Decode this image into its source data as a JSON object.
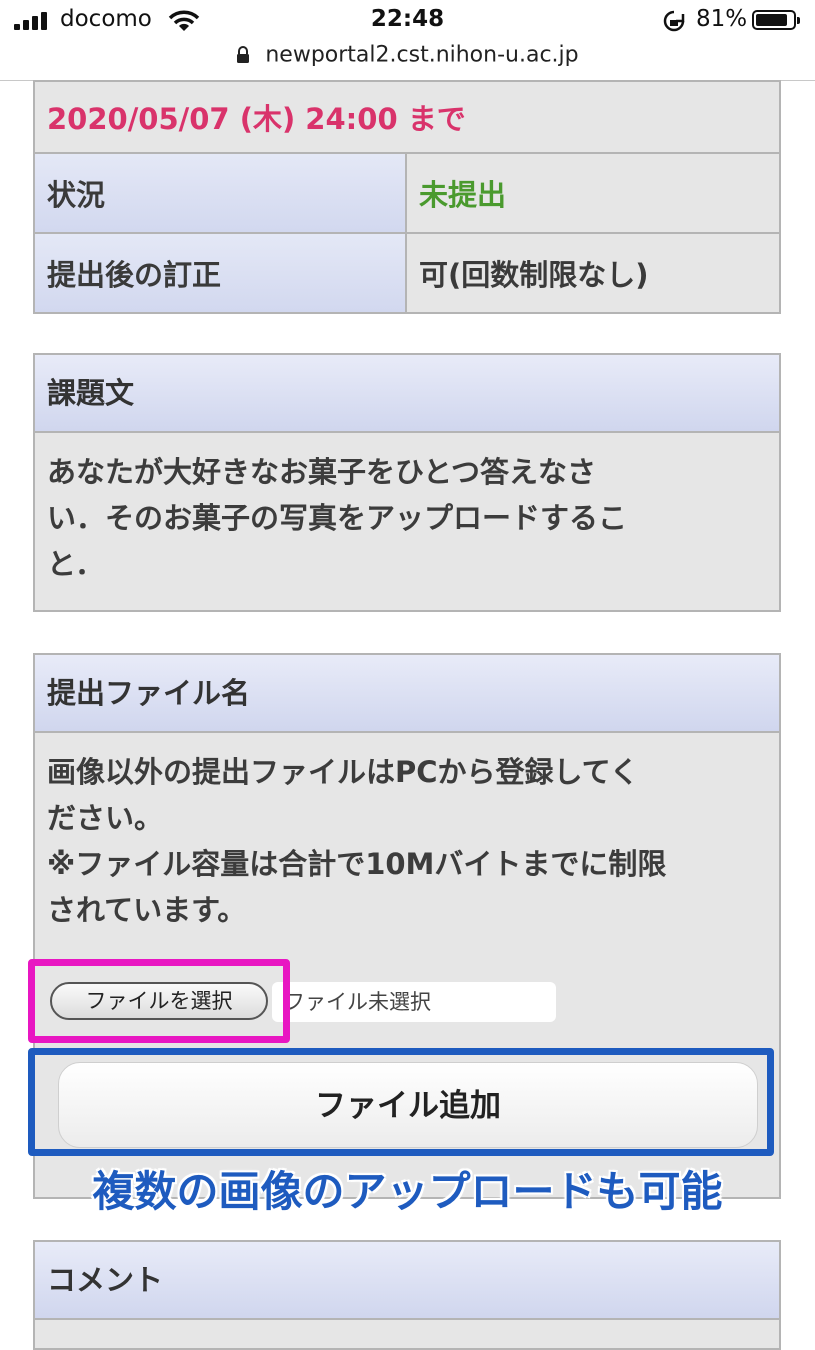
{
  "status_bar": {
    "carrier": "docomo",
    "time": "22:48",
    "battery_pct": "81%",
    "battery_level": 0.81
  },
  "browser": {
    "url": "newportal2.cst.nihon-u.ac.jp"
  },
  "deadline": {
    "text": "2020/05/07 (木) 24:00 まで",
    "color": "#d9336b"
  },
  "status_table": [
    {
      "label": "状況",
      "value": "未提出",
      "value_color": "#4a9a2e"
    },
    {
      "label": "提出後の訂正",
      "value": "可(回数制限なし)",
      "value_color": "#3a3a3a"
    }
  ],
  "assignment": {
    "header": "課題文",
    "lines": [
      "あなたが大好きなお菓子をひとつ答えなさ",
      "い．そのお菓子の写真をアップロードするこ",
      "と．"
    ]
  },
  "submission": {
    "header": "提出ファイル名",
    "lines": [
      "画像以外の提出ファイルはPCから登録してく",
      "ださい。",
      "※ファイル容量は合計で10Mバイトまでに制限",
      "されています。"
    ],
    "choose_file_label": "ファイルを選択",
    "no_file_label": "ファイル未選択",
    "add_file_label": "ファイル追加"
  },
  "annotation": {
    "caption": "複数の画像のアップロードも可能",
    "highlight_colors": [
      "#e817c2",
      "#1e5bbf"
    ]
  },
  "comment": {
    "header": "コメント"
  }
}
